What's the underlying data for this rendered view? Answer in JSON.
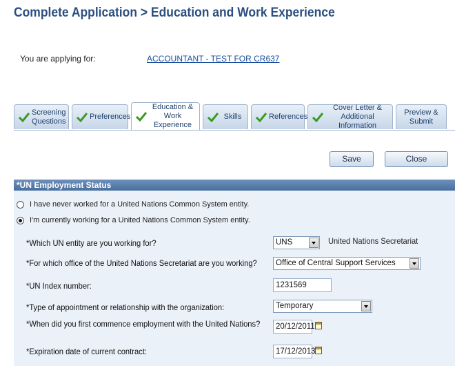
{
  "header": {
    "title": "Complete Application > Education and Work Experience"
  },
  "applying": {
    "label": "You are applying for:",
    "job": "ACCOUNTANT - TEST FOR CR637"
  },
  "tabs": [
    {
      "line1": "Screening",
      "line2": "Questions"
    },
    {
      "line1": "Preferences",
      "line2": ""
    },
    {
      "line1": "Education &",
      "line2": "Work Experience"
    },
    {
      "line1": "Skills",
      "line2": ""
    },
    {
      "line1": "References",
      "line2": ""
    },
    {
      "line1": "Cover Letter &",
      "line2": "Additional Information"
    },
    {
      "line1": "Preview &",
      "line2": "Submit"
    }
  ],
  "toolbar": {
    "save_label": "Save",
    "close_label": "Close"
  },
  "section": {
    "title": "*UN Employment Status",
    "option_never": "I have never worked for a United Nations Common System entity.",
    "option_current": "I'm currently working for a United Nations Common System entity.",
    "selected_option": "current"
  },
  "form": {
    "entity_label": "*Which UN entity are you working for?",
    "entity_value": "UNS",
    "entity_name": "United Nations Secretariat",
    "office_label": "*For which office of the United Nations Secretariat are you working?",
    "office_value": "Office of Central Support Services",
    "index_label": "*UN Index number:",
    "index_value": "1231569",
    "appointment_label": "*Type of appointment or relationship with the organization:",
    "appointment_value": "Temporary",
    "commence_label": "*When did you first commence employment with the United Nations?",
    "commence_value": "20/12/2011",
    "expiration_label": "*Expiration date of current contract:",
    "expiration_value": "17/12/2013"
  },
  "colors": {
    "title": "#2b4f80",
    "section_header": "#4a6f9d",
    "section_body": "#eaf1f9",
    "check_green": "#3a9a1e"
  }
}
